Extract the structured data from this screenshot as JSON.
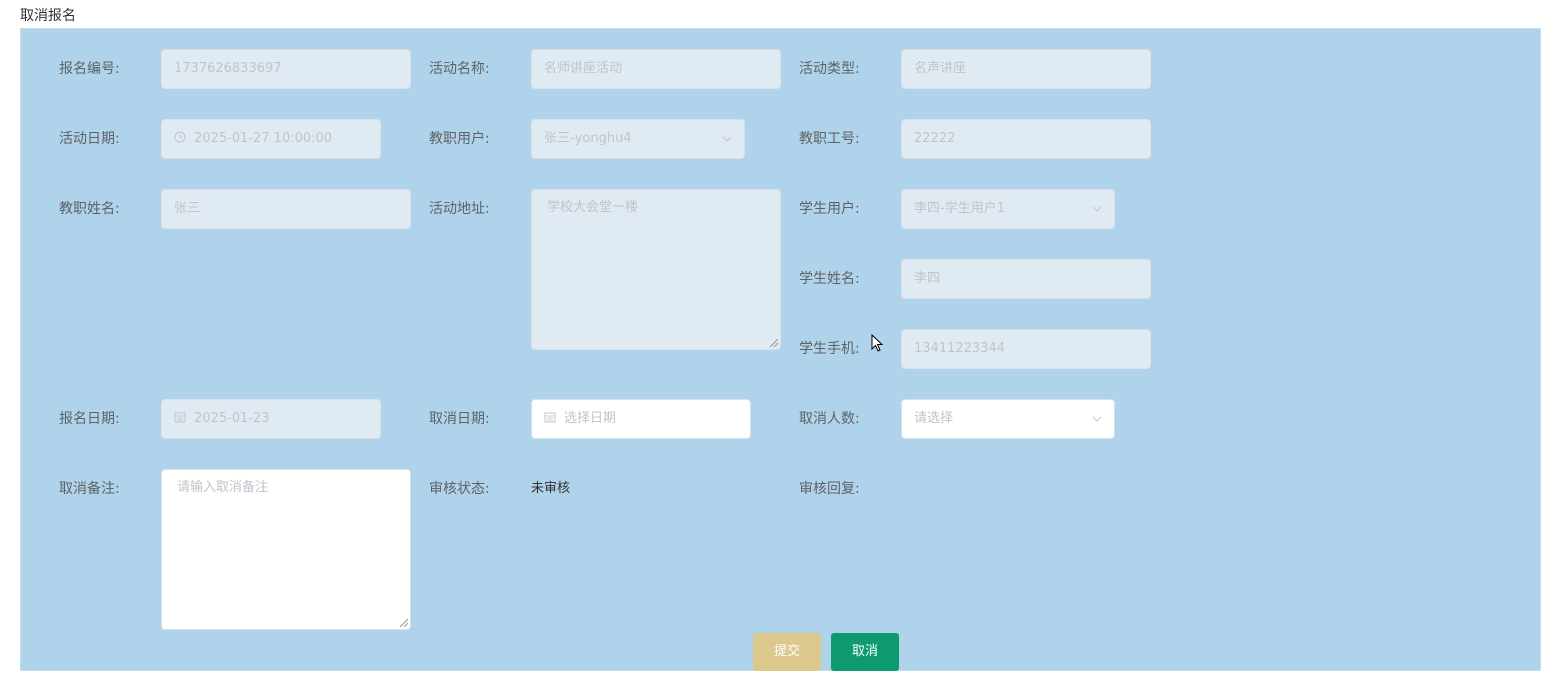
{
  "page": {
    "title": "取消报名"
  },
  "form": {
    "baoming_bianhao": {
      "label": "报名编号:",
      "value": "1737626833697"
    },
    "huodong_mingcheng": {
      "label": "活动名称:",
      "value": "名师讲座活动"
    },
    "huodong_leixing": {
      "label": "活动类型:",
      "value": "名声讲座"
    },
    "huodong_riqi": {
      "label": "活动日期:",
      "value": "2025-01-27 10:00:00",
      "icon": "clock-icon"
    },
    "jiaozhi_yonghu": {
      "label": "教职用户:",
      "value": "张三-yonghu4"
    },
    "jiaozhi_gonghao": {
      "label": "教职工号:",
      "value": "22222"
    },
    "jiaozhi_xingming": {
      "label": "教职姓名:",
      "value": "张三"
    },
    "huodong_dizhi": {
      "label": "活动地址:",
      "value": "学校大会堂一楼"
    },
    "xuesheng_yonghu": {
      "label": "学生用户:",
      "value": "李四-学生用户1"
    },
    "xuesheng_xingming": {
      "label": "学生姓名:",
      "value": "李四"
    },
    "xuesheng_shouji": {
      "label": "学生手机:",
      "value": "13411223344"
    },
    "baoming_riqi": {
      "label": "报名日期:",
      "value": "2025-01-23",
      "icon": "calendar-icon"
    },
    "quxiao_riqi": {
      "label": "取消日期:",
      "placeholder": "选择日期",
      "icon": "calendar-icon"
    },
    "quxiao_renshu": {
      "label": "取消人数:",
      "placeholder": "请选择"
    },
    "quxiao_beizhu": {
      "label": "取消备注:",
      "placeholder": "请输入取消备注"
    },
    "shenhe_zhuangtai": {
      "label": "审核状态:",
      "value": "未审核"
    },
    "shenhe_huifu": {
      "label": "审核回复:"
    }
  },
  "buttons": {
    "submit": "提交",
    "cancel": "取消"
  }
}
